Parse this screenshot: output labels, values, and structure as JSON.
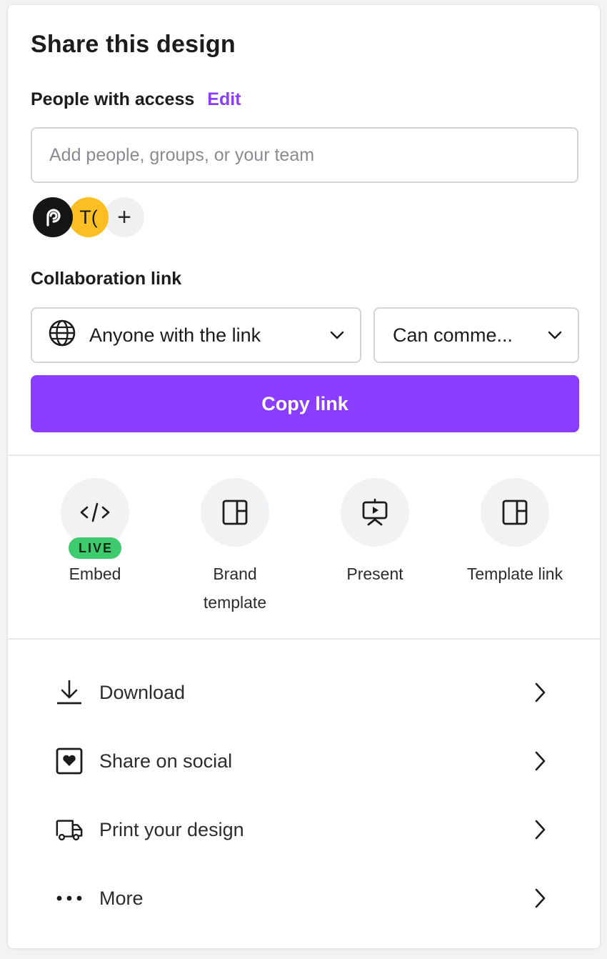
{
  "header": {
    "title": "Share this design"
  },
  "people_access": {
    "label": "People with access",
    "edit_label": "Edit",
    "input_placeholder": "Add people, groups, or your team",
    "input_value": "",
    "avatars": [
      {
        "name": "brand-avatar",
        "initials": "",
        "color": "#151515"
      },
      {
        "name": "user-avatar",
        "initials": "T(",
        "color": "#fbbf24"
      }
    ],
    "add_symbol": "+"
  },
  "collaboration": {
    "label": "Collaboration link",
    "access_select": {
      "icon": "globe-icon",
      "value": "Anyone with the link"
    },
    "permission_select": {
      "value": "Can comme..."
    },
    "copy_button": "Copy link"
  },
  "actions": [
    {
      "id": "embed",
      "icon": "code-icon",
      "label": "Embed",
      "badge": "LIVE"
    },
    {
      "id": "brand-template",
      "icon": "layout-icon",
      "label": "Brand template"
    },
    {
      "id": "present",
      "icon": "presentation-icon",
      "label": "Present"
    },
    {
      "id": "template-link",
      "icon": "layout-icon",
      "label": "Template link"
    }
  ],
  "menu": [
    {
      "id": "download",
      "icon": "download-icon",
      "label": "Download"
    },
    {
      "id": "share-social",
      "icon": "heart-frame-icon",
      "label": "Share on social"
    },
    {
      "id": "print",
      "icon": "truck-icon",
      "label": "Print your design"
    },
    {
      "id": "more",
      "icon": "more-dots-icon",
      "label": "More"
    }
  ],
  "colors": {
    "accent": "#8b3dff",
    "live_badge": "#3ecb6e",
    "avatar_yellow": "#fbbf24"
  }
}
